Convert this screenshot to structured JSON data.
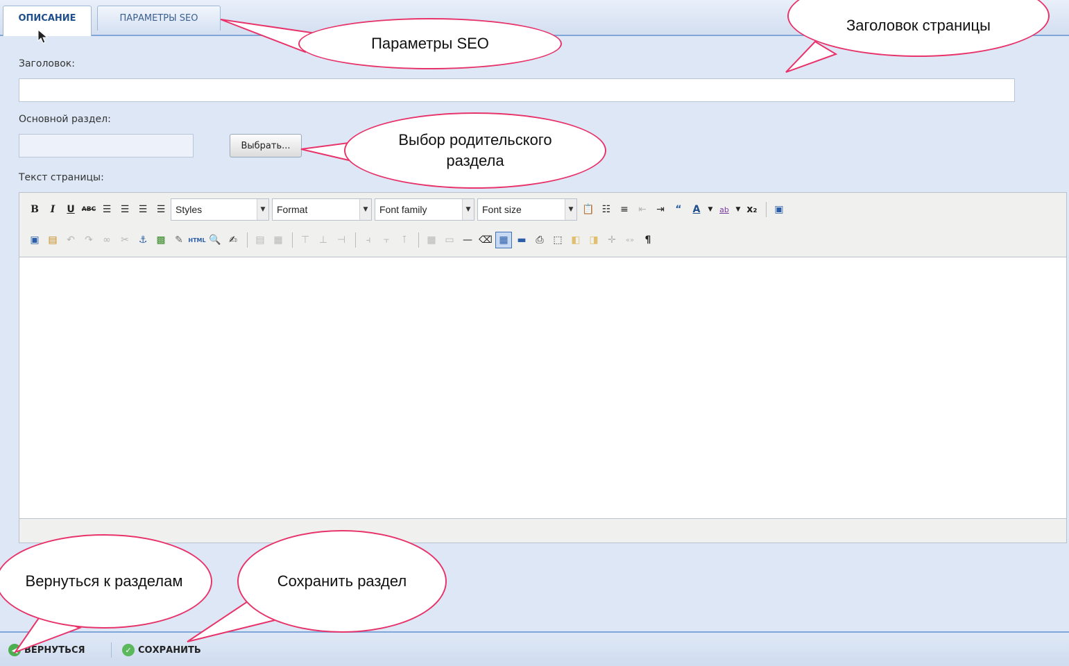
{
  "tabs": {
    "description": "ОПИСАНИЕ",
    "seo": "ПАРАМЕТРЫ SEO"
  },
  "form": {
    "title_label": "Заголовок:",
    "title_value": "",
    "section_label": "Основной раздел:",
    "section_value": "",
    "choose_button": "Выбрать...",
    "text_label": "Текст страницы:"
  },
  "editor": {
    "styles": "Styles",
    "format": "Format",
    "font_family": "Font family",
    "font_size": "Font size"
  },
  "bottom": {
    "back": "ВЕРНУТЬСЯ",
    "save": "СОХРАНИТЬ"
  },
  "callouts": {
    "seo": "Параметры SEO",
    "page_title": "Заголовок страницы",
    "parent": "Выбор родительского раздела",
    "back": "Вернуться к разделам",
    "save": "Сохранить раздел"
  },
  "colors": {
    "callout_border": "#e8336a",
    "tab_active_text": "#1f4e8c",
    "accent_line": "#7fa6d8"
  }
}
